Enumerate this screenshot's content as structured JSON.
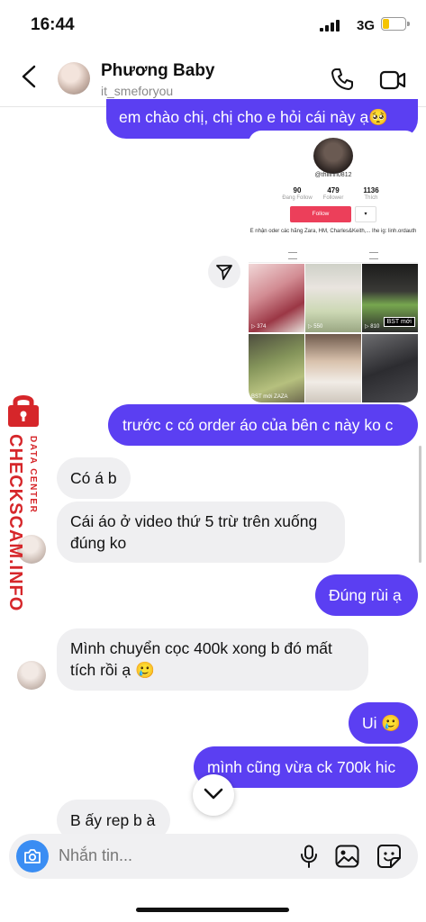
{
  "status_bar": {
    "time": "16:44",
    "network": "3G"
  },
  "header": {
    "name": "Phương Baby",
    "username": "it_smeforyou"
  },
  "shared_profile": {
    "username": "@thilinh0812",
    "stats": [
      {
        "value": "90",
        "label": "Đang Follow"
      },
      {
        "value": "479",
        "label": "Follower"
      },
      {
        "value": "1136",
        "label": "Thích"
      }
    ],
    "follow_label": "Follow",
    "bio": "E nhận oder các hãng Zara, HM, Charles&Keith,... Ihe ig: linh.ordauth",
    "tiles": [
      {
        "caption": "▷ 374"
      },
      {
        "caption": "▷ 550"
      },
      {
        "caption": "▷ 810",
        "tag": "BST mới"
      },
      {
        "caption": "BST mới ZAZA"
      },
      {
        "caption": ""
      },
      {
        "caption": ""
      }
    ]
  },
  "messages": [
    {
      "side": "out",
      "text": "em chào chị, chị cho e hỏi cái này ạ🥺"
    },
    {
      "side": "out",
      "text": "trước c có order áo của bên c này ko c"
    },
    {
      "side": "in",
      "text": "Có á b"
    },
    {
      "side": "in",
      "text": "Cái áo ở video thứ 5 trừ trên xuống đúng ko"
    },
    {
      "side": "out",
      "text": "Đúng rùi ạ"
    },
    {
      "side": "in",
      "text": "Mình chuyển cọc 400k xong b đó mất tích rồi ạ 🥲"
    },
    {
      "side": "out",
      "text": "Ui 🥲"
    },
    {
      "side": "out",
      "text": "mình cũng vừa ck 700k hic"
    },
    {
      "side": "in",
      "text": "B ấy rep b à"
    }
  ],
  "watermark": {
    "brand": "CHECKSCAM.INFO",
    "sub": "DATA CENTER"
  },
  "composer": {
    "placeholder": "Nhắn tin..."
  },
  "colors": {
    "outgoing": "#5b3ff2",
    "incoming": "#efeff1",
    "camera": "#3a8df3",
    "watermark": "#d6262a"
  }
}
